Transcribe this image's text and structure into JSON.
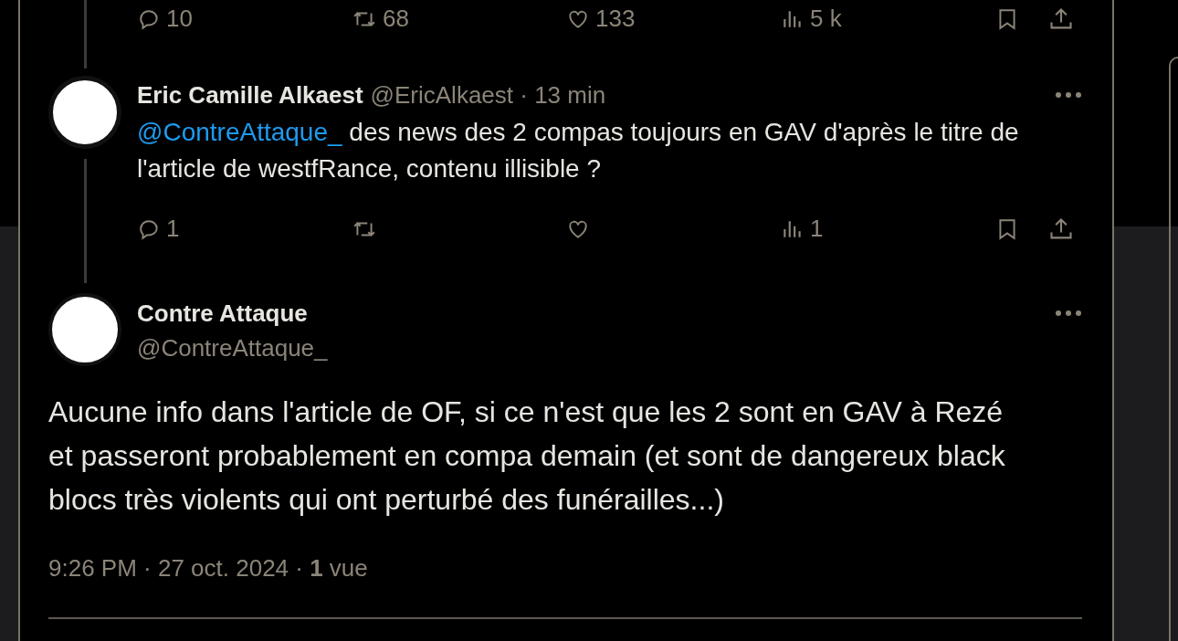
{
  "previous_tweet": {
    "actions": {
      "replies": "10",
      "reposts": "68",
      "likes": "133",
      "views": "5 k"
    }
  },
  "reply": {
    "name": "Eric Camille Alkaest",
    "handle_line": "@EricAlkaest · 13 min",
    "mention": "@ContreAttaque_",
    "text": " des news des 2 compas toujours en GAV d'après le titre de l'article de westfRance, contenu illisible ?",
    "actions": {
      "replies": "1",
      "views": "1"
    }
  },
  "main_tweet": {
    "name": "Contre Attaque",
    "handle": "@ContreAttaque_",
    "text": "Aucune info dans l'article de OF, si ce n'est que les 2 sont en GAV à Rezé et passeront probablement en compa demain (et sont de dangereux black blocs très violents qui ont perturbé des funérailles...)",
    "meta": "9:26 PM · 27 oct. 2024 · **1** vue"
  }
}
